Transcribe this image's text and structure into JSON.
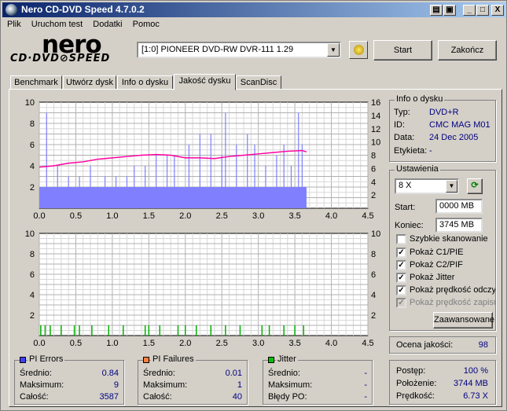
{
  "window": {
    "title": "Nero CD-DVD Speed 4.7.0.2",
    "min": "_",
    "max": "□",
    "close": "X"
  },
  "menu": [
    "Plik",
    "Uruchom test",
    "Dodatki",
    "Pomoc"
  ],
  "logo": {
    "brand": "nero",
    "product": "CD·DVD⊘SPEED"
  },
  "drive": {
    "selected": "[1:0]  PIONEER DVD-RW  DVR-111 1.29"
  },
  "buttons": {
    "start": "Start",
    "exit": "Zakończ",
    "advanced": "Zaawansowane"
  },
  "tabs": [
    "Benchmark",
    "Utwórz dysk",
    "Info o dysku",
    "Jakość dysku",
    "ScanDisc"
  ],
  "active_tab": "Jakość dysku",
  "disc_info": {
    "title": "Info o dysku",
    "rows": [
      {
        "label": "Typ:",
        "value": "DVD+R"
      },
      {
        "label": "ID:",
        "value": "CMC MAG M01"
      },
      {
        "label": "Data:",
        "value": "24 Dec 2005"
      },
      {
        "label": "Etykieta:",
        "value": "-"
      }
    ]
  },
  "settings": {
    "title": "Ustawienia",
    "speed": "8 X",
    "start_label": "Start:",
    "start_value": "0000 MB",
    "end_label": "Koniec:",
    "end_value": "3745 MB",
    "checkboxes": [
      {
        "label": "Szybkie skanowanie",
        "checked": false,
        "disabled": false
      },
      {
        "label": "Pokaż C1/PIE",
        "checked": true,
        "disabled": false
      },
      {
        "label": "Pokaż C2/PIF",
        "checked": true,
        "disabled": false
      },
      {
        "label": "Pokaż Jitter",
        "checked": true,
        "disabled": false
      },
      {
        "label": "Pokaż prędkość odczytu",
        "checked": true,
        "disabled": false
      },
      {
        "label": "Pokaż prędkość zapisu",
        "checked": true,
        "disabled": true
      }
    ]
  },
  "quality": {
    "label": "Ocena jakości:",
    "value": "98"
  },
  "progress": {
    "rows": [
      {
        "label": "Postęp:",
        "value": "100 %"
      },
      {
        "label": "Położenie:",
        "value": "3744 MB"
      },
      {
        "label": "Prędkość:",
        "value": "6.73 X"
      }
    ]
  },
  "pi_errors": {
    "title": "PI Errors",
    "color": "#4040ff",
    "rows": [
      {
        "label": "Średnio:",
        "value": "0.84"
      },
      {
        "label": "Maksimum:",
        "value": "9"
      },
      {
        "label": "Całość:",
        "value": "3587"
      }
    ]
  },
  "pi_failures": {
    "title": "PI Failures",
    "color": "#ff8040",
    "rows": [
      {
        "label": "Średnio:",
        "value": "0.01"
      },
      {
        "label": "Maksimum:",
        "value": "1"
      },
      {
        "label": "Całość:",
        "value": "40"
      }
    ]
  },
  "jitter": {
    "title": "Jitter",
    "color": "#00c000",
    "rows": [
      {
        "label": "Średnio:",
        "value": "-"
      },
      {
        "label": "Maksimum:",
        "value": "-"
      },
      {
        "label": "Błędy PO:",
        "value": "-"
      }
    ]
  },
  "chart_data": [
    {
      "type": "bar",
      "x_ticks": [
        "0.0",
        "0.5",
        "1.0",
        "1.5",
        "2.0",
        "2.5",
        "3.0",
        "3.5",
        "4.0",
        "4.5"
      ],
      "y_left_ticks": [
        "2",
        "4",
        "6",
        "8",
        "10"
      ],
      "y_right_ticks": [
        "2",
        "4",
        "6",
        "8",
        "10",
        "12",
        "14",
        "16"
      ],
      "xlim": [
        0,
        4.5
      ],
      "ylim": [
        0,
        10
      ],
      "y2lim": [
        0,
        16
      ],
      "series": [
        {
          "kind": "bars",
          "color": "#8080ff",
          "baseline": 2,
          "end_x": 3.66,
          "spikes": [
            [
              0.1,
              9
            ],
            [
              0.25,
              4
            ],
            [
              0.4,
              3
            ],
            [
              0.55,
              3
            ],
            [
              0.7,
              4
            ],
            [
              0.9,
              3
            ],
            [
              1.05,
              3
            ],
            [
              1.2,
              3
            ],
            [
              1.3,
              4
            ],
            [
              1.45,
              4
            ],
            [
              1.6,
              5
            ],
            [
              1.75,
              5
            ],
            [
              1.85,
              5
            ],
            [
              2.05,
              6
            ],
            [
              2.2,
              7
            ],
            [
              2.35,
              7
            ],
            [
              2.5,
              5
            ],
            [
              2.55,
              9
            ],
            [
              2.7,
              6
            ],
            [
              2.85,
              7
            ],
            [
              2.95,
              6
            ],
            [
              3.1,
              4
            ],
            [
              3.25,
              5
            ],
            [
              3.35,
              6
            ],
            [
              3.45,
              4
            ],
            [
              3.55,
              9
            ],
            [
              3.6,
              6
            ]
          ]
        },
        {
          "kind": "line",
          "color": "#ff00a0",
          "axis": "right",
          "points": [
            [
              0.0,
              6.2
            ],
            [
              0.2,
              6.4
            ],
            [
              0.4,
              6.8
            ],
            [
              0.6,
              7.0
            ],
            [
              0.8,
              7.4
            ],
            [
              1.0,
              7.6
            ],
            [
              1.2,
              7.8
            ],
            [
              1.4,
              8.0
            ],
            [
              1.6,
              8.1
            ],
            [
              1.8,
              8.0
            ],
            [
              2.0,
              7.6
            ],
            [
              2.2,
              7.6
            ],
            [
              2.4,
              7.5
            ],
            [
              2.6,
              7.8
            ],
            [
              2.8,
              8.0
            ],
            [
              3.0,
              8.2
            ],
            [
              3.2,
              8.4
            ],
            [
              3.4,
              8.6
            ],
            [
              3.6,
              8.7
            ],
            [
              3.66,
              8.5
            ]
          ]
        }
      ]
    },
    {
      "type": "bar",
      "x_ticks": [
        "0.0",
        "0.5",
        "1.0",
        "1.5",
        "2.0",
        "2.5",
        "3.0",
        "3.5",
        "4.0",
        "4.5"
      ],
      "y_left_ticks": [
        "2",
        "4",
        "6",
        "8",
        "10"
      ],
      "y_right_ticks": [
        "2",
        "4",
        "6",
        "8",
        "10"
      ],
      "xlim": [
        0,
        4.5
      ],
      "ylim": [
        0,
        10
      ],
      "series": [
        {
          "kind": "bars",
          "color": "#00b000",
          "values": [
            [
              0.02,
              1
            ],
            [
              0.08,
              1
            ],
            [
              0.15,
              1
            ],
            [
              0.3,
              1
            ],
            [
              0.48,
              1
            ],
            [
              0.55,
              1
            ],
            [
              0.72,
              1
            ],
            [
              0.95,
              1
            ],
            [
              1.15,
              1
            ],
            [
              1.45,
              1
            ],
            [
              1.5,
              1
            ],
            [
              1.65,
              1
            ],
            [
              1.9,
              1
            ],
            [
              2.0,
              1
            ],
            [
              2.15,
              1
            ],
            [
              2.35,
              1
            ],
            [
              2.55,
              1
            ],
            [
              2.75,
              1
            ],
            [
              3.05,
              1
            ],
            [
              3.15,
              1
            ],
            [
              3.35,
              1
            ],
            [
              3.5,
              1
            ],
            [
              3.62,
              1
            ]
          ]
        }
      ]
    }
  ]
}
